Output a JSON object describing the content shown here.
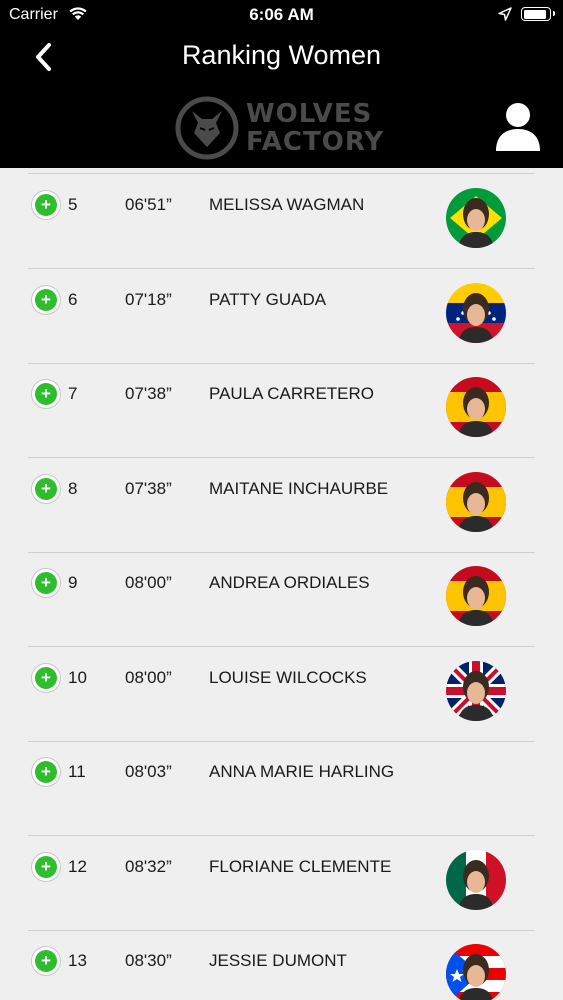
{
  "status": {
    "carrier": "Carrier",
    "time": "6:06 AM",
    "battery_level": 0.95
  },
  "header": {
    "title": "Ranking Women",
    "logo_line1": "WOLVES",
    "logo_line2": "FACTORY"
  },
  "icons": {
    "back": "chevron-left-icon",
    "profile": "user-icon",
    "add": "plus-circle-icon",
    "wifi": "wifi-icon",
    "location": "location-arrow-icon",
    "battery": "battery-icon"
  },
  "colors": {
    "header_bg": "#000000",
    "accent_green": "#2dbd2d",
    "list_bg": "#efeff0"
  },
  "rankings": [
    {
      "position": "5",
      "time": "06'51”",
      "name": "MELISSA WAGMAN",
      "flag": "brazil"
    },
    {
      "position": "6",
      "time": "07'18”",
      "name": "PATTY GUADA",
      "flag": "venezuela"
    },
    {
      "position": "7",
      "time": "07'38”",
      "name": "PAULA CARRETERO",
      "flag": "spain"
    },
    {
      "position": "8",
      "time": "07'38”",
      "name": "MAITANE INCHAURBE",
      "flag": "spain"
    },
    {
      "position": "9",
      "time": "08'00”",
      "name": "ANDREA ORDIALES",
      "flag": "spain"
    },
    {
      "position": "10",
      "time": "08'00”",
      "name": "LOUISE WILCOCKS",
      "flag": "uk"
    },
    {
      "position": "11",
      "time": "08'03”",
      "name": "ANNA MARIE HARLING",
      "flag": ""
    },
    {
      "position": "12",
      "time": "08'32”",
      "name": "FLORIANE CLEMENTE",
      "flag": "mexico"
    },
    {
      "position": "13",
      "time": "08'30”",
      "name": "JESSIE DUMONT",
      "flag": "puerto-rico"
    }
  ]
}
